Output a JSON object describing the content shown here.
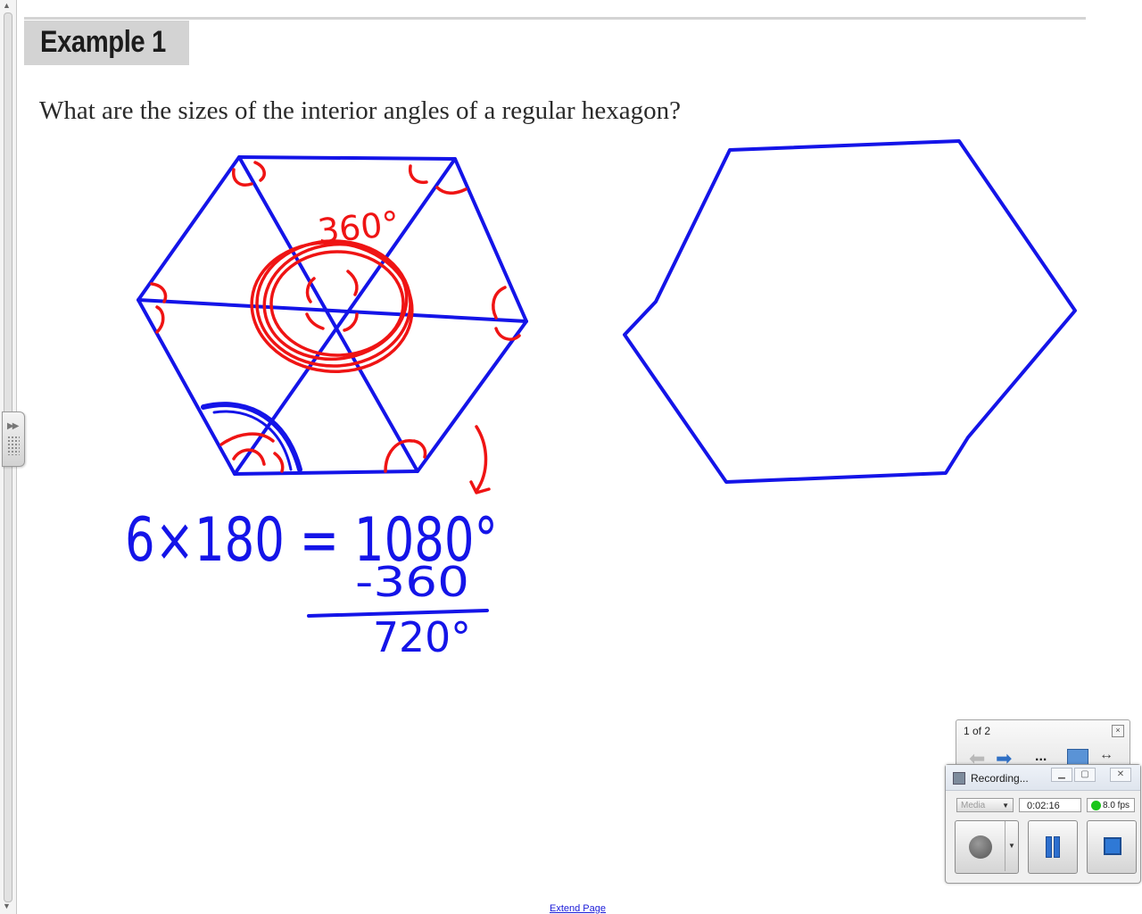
{
  "lesson": {
    "example_title": "Example 1",
    "question": "What are the sizes of the interior angles of a regular hexagon?"
  },
  "annotations": {
    "angle_label": "360°",
    "calc_line1": "6×180 = 1080°",
    "calc_line2": "-360",
    "calc_result": "720°",
    "colors": {
      "ink_blue": "#1414e8",
      "ink_red": "#ef1414"
    }
  },
  "page_nav": {
    "page_indicator": "1 of 2",
    "close_label": "×",
    "back_icon": "arrow-left-icon",
    "forward_icon": "arrow-right-icon",
    "more_label": "...",
    "expand_icon": "double-arrow-icon"
  },
  "recorder": {
    "title": "Recording...",
    "media_select": "Media",
    "elapsed": "0:02:16",
    "fps": "8.0 fps",
    "status_color": "#19c519",
    "record_icon": "record-icon",
    "pause_icon": "pause-icon",
    "stop_icon": "stop-icon"
  },
  "footer": {
    "extend_link": "Extend Page"
  }
}
